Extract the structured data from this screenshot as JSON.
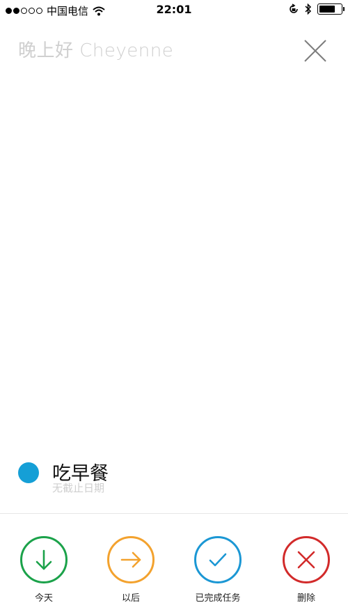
{
  "status_bar": {
    "carrier": "中国电信",
    "time": "22:01",
    "signal_strength": 2,
    "signal_total": 5,
    "battery_level": 0.75
  },
  "header": {
    "greeting": "晚上好 Cheyenne",
    "close_icon": "close-icon"
  },
  "task": {
    "title": "吃早餐",
    "subtitle": "无截止日期",
    "dot_color": "#159fd6"
  },
  "actions": [
    {
      "label": "今天",
      "icon": "arrow-down-icon",
      "color": "#1ba24a"
    },
    {
      "label": "以后",
      "icon": "arrow-right-icon",
      "color": "#f3a22e"
    },
    {
      "label": "已完成任务",
      "icon": "checkmark-icon",
      "color": "#1b97d4"
    },
    {
      "label": "删除",
      "icon": "x-icon",
      "color": "#d22a2a"
    }
  ]
}
